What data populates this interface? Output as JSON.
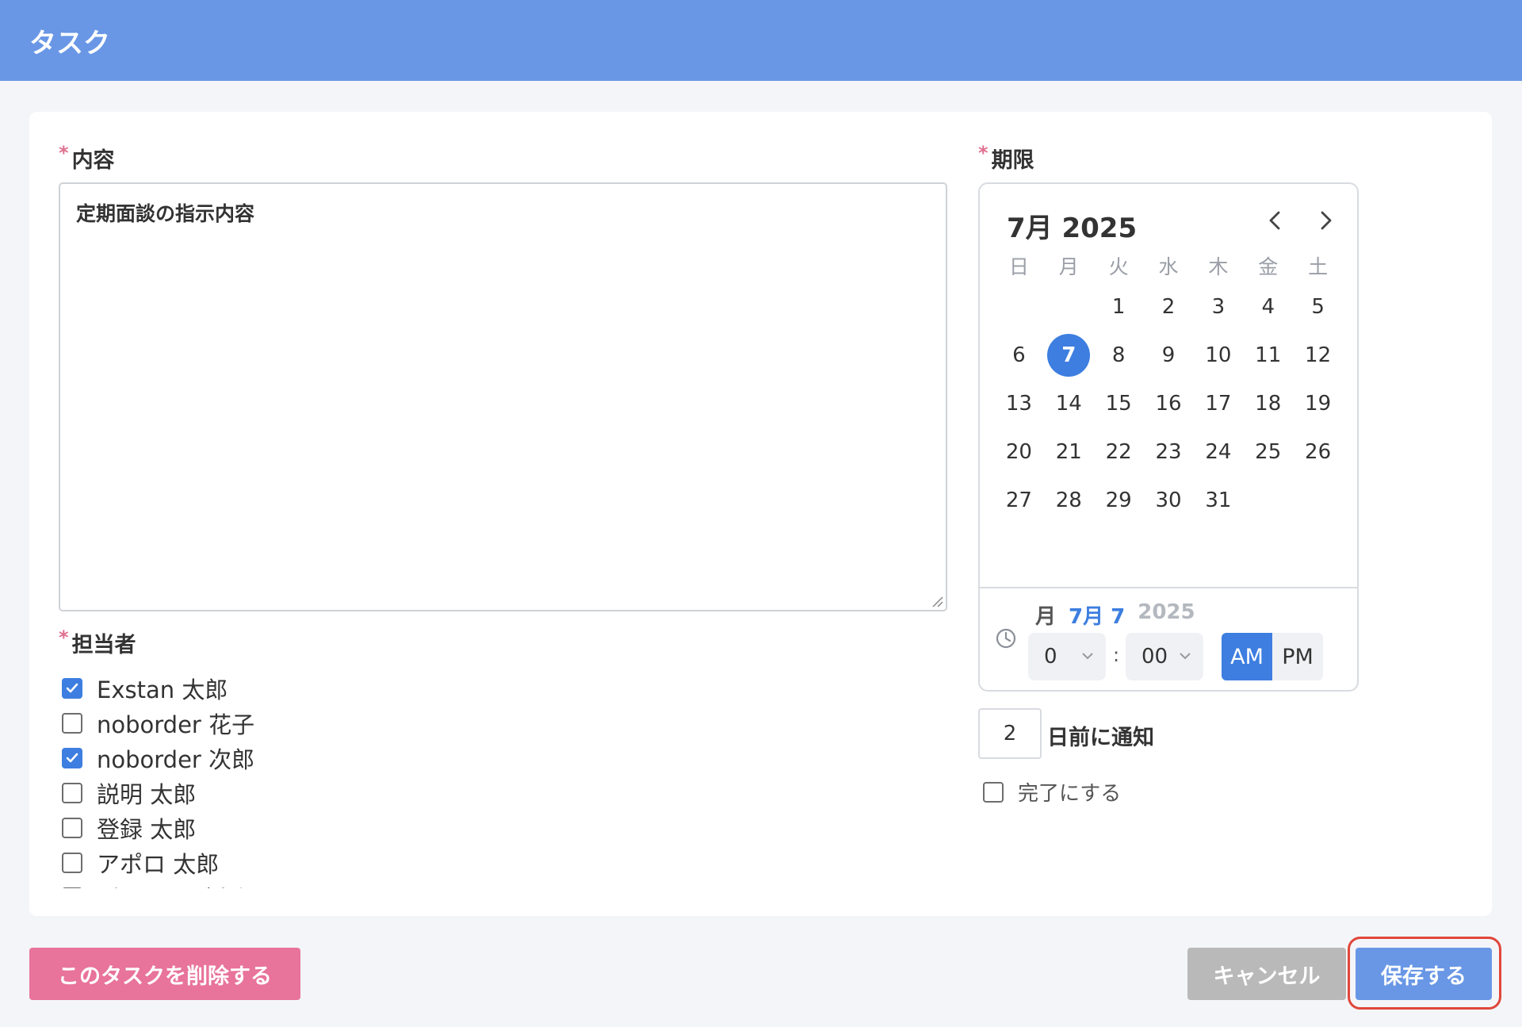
{
  "header": {
    "title": "タスク"
  },
  "content": {
    "label": "内容",
    "required_mark": "*",
    "value": "定期面談の指示内容"
  },
  "assignees": {
    "label": "担当者",
    "required_mark": "*",
    "items": [
      {
        "name": "Exstan 太郎",
        "checked": true
      },
      {
        "name": "noborder 花子",
        "checked": false
      },
      {
        "name": "noborder 次郎",
        "checked": true
      },
      {
        "name": "説明 太郎",
        "checked": false
      },
      {
        "name": "登録 太郎",
        "checked": false
      },
      {
        "name": "アポロ 太郎",
        "checked": false
      },
      {
        "name": "ヴィッツブ太郎",
        "checked": false
      }
    ]
  },
  "deadline": {
    "label": "期限",
    "required_mark": "*",
    "month_title": "7月 2025",
    "weekdays": [
      "日",
      "月",
      "火",
      "水",
      "木",
      "金",
      "土"
    ],
    "weeks": [
      [
        "",
        "",
        "1",
        "2",
        "3",
        "4",
        "5"
      ],
      [
        "6",
        "7",
        "8",
        "9",
        "10",
        "11",
        "12"
      ],
      [
        "13",
        "14",
        "15",
        "16",
        "17",
        "18",
        "19"
      ],
      [
        "20",
        "21",
        "22",
        "23",
        "24",
        "25",
        "26"
      ],
      [
        "27",
        "28",
        "29",
        "30",
        "31",
        "",
        ""
      ]
    ],
    "selected_day": "7",
    "selected_weekday": "月",
    "selected_month_day": "7月 7",
    "selected_year": "2025",
    "hour": "0",
    "minute": "00",
    "time_separator": ":",
    "am_label": "AM",
    "pm_label": "PM",
    "meridiem": "AM"
  },
  "notify": {
    "days": "2",
    "label": "日前に通知"
  },
  "complete": {
    "label": "完了にする",
    "checked": false
  },
  "buttons": {
    "delete": "このタスクを削除する",
    "cancel": "キャンセル",
    "save": "保存する"
  },
  "colors": {
    "header": "#6997e6",
    "accent": "#3d7ee0",
    "delete": "#e8739b",
    "cancel": "#b9b9b9",
    "highlight": "#e0463a"
  }
}
